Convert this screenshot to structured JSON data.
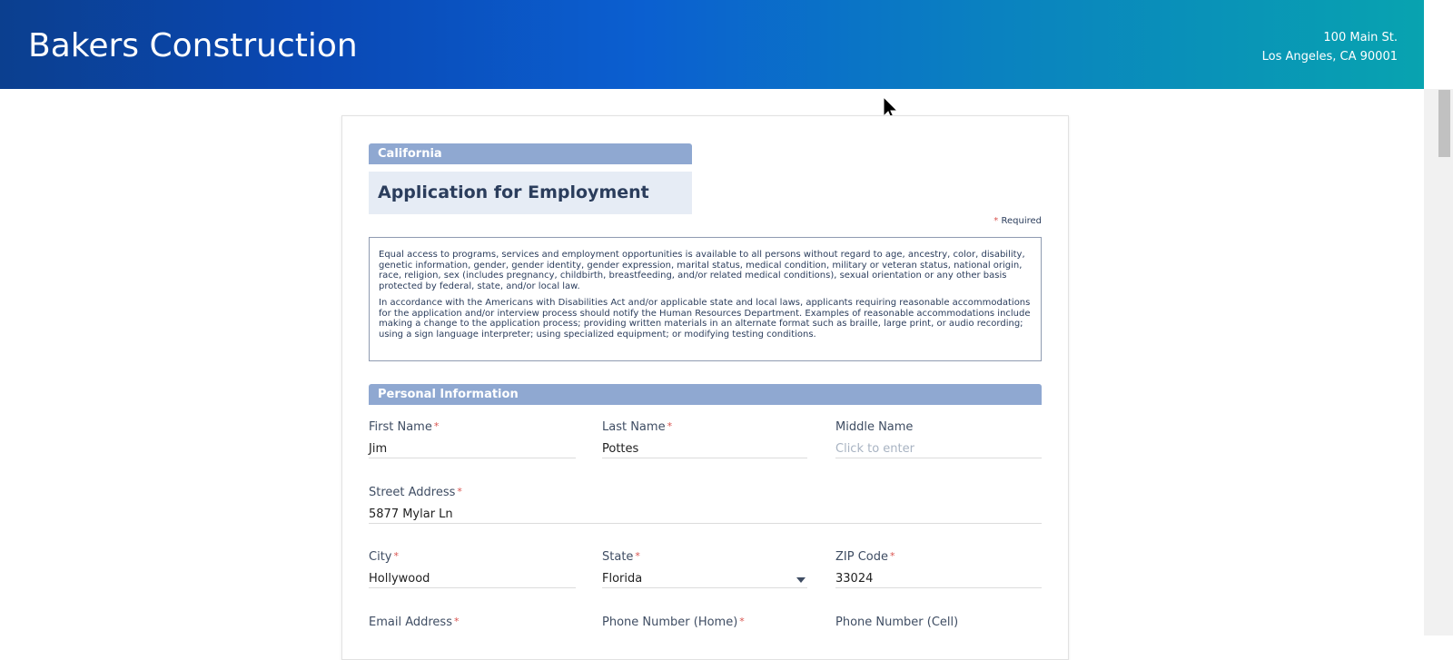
{
  "header": {
    "company": "Bakers Construction",
    "address_line1": "100 Main St.",
    "address_line2": "Los Angeles, CA 90001"
  },
  "form": {
    "state_tag": "California",
    "title": "Application for Employment",
    "required_note": "Required",
    "required_marker": "*",
    "notice_p1": "Equal access to programs, services and employment opportunities is available to all persons without regard to age, ancestry, color, disability, genetic information, gender, gender identity, gender expression, marital status, medical condition, military or veteran status, national origin, race, religion, sex (includes pregnancy, childbirth, breastfeeding, and/or related medical conditions), sexual orientation or any other basis protected by federal, state, and/or local law.",
    "notice_p2": "In accordance with the Americans with Disabilities Act and/or applicable state and local laws, applicants requiring reasonable accommodations for the application and/or interview process should notify the Human Resources Department. Examples of reasonable accommodations include making a change to the application process; providing written materials in an alternate format such as braille, large print, or audio recording; using a sign language interpreter; using specialized equipment; or modifying testing conditions.",
    "section_personal": "Personal Information",
    "fields": {
      "first_name": {
        "label": "First Name",
        "value": "Jim"
      },
      "last_name": {
        "label": "Last Name",
        "value": "Pottes"
      },
      "middle_name": {
        "label": "Middle Name",
        "placeholder": "Click to enter"
      },
      "street": {
        "label": "Street Address",
        "value": "5877 Mylar Ln"
      },
      "city": {
        "label": "City",
        "value": "Hollywood"
      },
      "state": {
        "label": "State",
        "value": "Florida"
      },
      "zip": {
        "label": "ZIP Code",
        "value": "33024"
      },
      "email": {
        "label": "Email Address"
      },
      "phone_home": {
        "label": "Phone Number (Home)"
      },
      "phone_cell": {
        "label": "Phone Number (Cell)"
      }
    }
  },
  "colors": {
    "header_start": "#0b3f8f",
    "header_end": "#08a3b0",
    "section_bar": "#8fa8d1",
    "required_star": "#d9534f"
  }
}
